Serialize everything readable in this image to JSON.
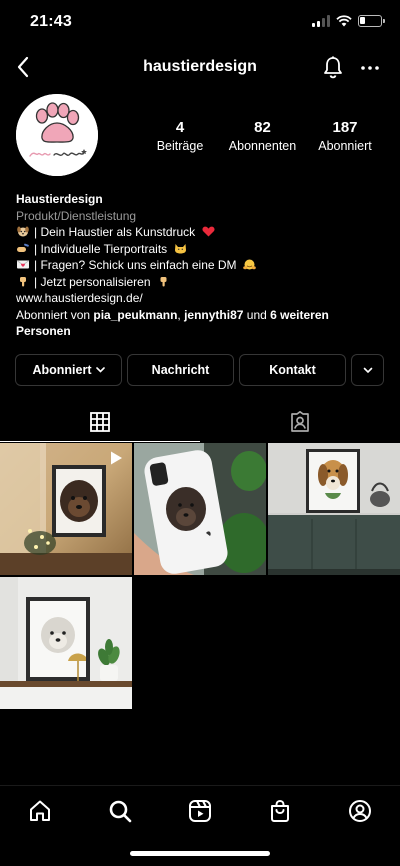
{
  "status_bar": {
    "time": "21:43"
  },
  "header": {
    "username": "haustierdesign"
  },
  "profile": {
    "avatar_logo_text": "haustierdesign",
    "stats": [
      {
        "value": "4",
        "label": "Beiträge"
      },
      {
        "value": "82",
        "label": "Abonnenten"
      },
      {
        "value": "187",
        "label": "Abonniert"
      }
    ]
  },
  "bio": {
    "name": "Haustierdesign",
    "category": "Produkt/Dienstleistung",
    "lines": [
      "| Dein Haustier als Kunstdruck",
      "| Individuelle Tierportraits",
      "| Fragen? Schick uns einfach eine DM",
      "| Jetzt personalisieren"
    ],
    "website": "www.haustierdesign.de/",
    "followed_by_prefix": "Abonniert von ",
    "followed_by_user1": "pia_peukmann",
    "followed_by_sep": ", ",
    "followed_by_user2": "jennythi87",
    "followed_by_and": " und ",
    "followed_by_others": "6 weiteren Personen"
  },
  "actions": {
    "follow_label": "Abonniert",
    "message_label": "Nachricht",
    "contact_label": "Kontakt"
  },
  "tabs": [
    {
      "icon": "grid-icon",
      "active": true
    },
    {
      "icon": "tagged-icon",
      "active": false
    }
  ],
  "posts": [
    {
      "icon": "reel-icon"
    },
    {},
    {},
    {}
  ],
  "colors": {
    "background": "#000000",
    "border": "#363636",
    "secondary_text": "#9a9a9a",
    "paw_pink": "#f0a6b8"
  }
}
